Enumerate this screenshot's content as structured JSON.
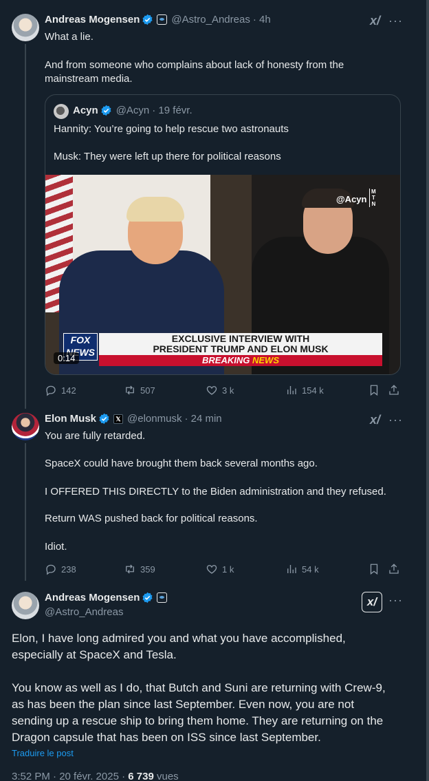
{
  "tweet1": {
    "name": "Andreas Mogensen",
    "handle": "@Astro_Andreas",
    "time": "· 4h",
    "lines": [
      "What a lie.",
      "And from someone who complains about lack of honesty from the",
      "mainstream media."
    ],
    "quote": {
      "name": "Acyn",
      "handle": "@Acyn",
      "time": "· 19 févr.",
      "lines": [
        "Hannity: You’re going to help rescue two astronauts",
        "Musk: They were left up there for political reasons"
      ],
      "video": {
        "tag": "@Acyn",
        "mtn": "M\nT\nN",
        "network": "FOX NEWS",
        "banner1": "EXCLUSIVE INTERVIEW WITH",
        "banner2": "PRESIDENT TRUMP AND ELON MUSK",
        "breaking1": "BREAKING",
        "breaking2": "NEWS",
        "duration": "0:14"
      }
    },
    "stats": {
      "replies": "142",
      "reposts": "507",
      "likes": "3 k",
      "views": "154 k"
    }
  },
  "tweet2": {
    "name": "Elon Musk",
    "badge": "𝕏",
    "handle": "@elonmusk",
    "time": "· 24 min",
    "lines": [
      "You are fully retarded.",
      "SpaceX could have brought them back several months ago.",
      "I OFFERED THIS DIRECTLY to the Biden administration and they refused.",
      "Return WAS pushed back for political reasons.",
      "Idiot."
    ],
    "stats": {
      "replies": "238",
      "reposts": "359",
      "likes": "1 k",
      "views": "54 k"
    }
  },
  "tweet3": {
    "name": "Andreas Mogensen",
    "handle": "@Astro_Andreas",
    "lines": [
      "Elon, I have long admired you and what you have accomplished,",
      "especially at SpaceX and Tesla.",
      "You know as well as I do, that Butch and Suni are returning with Crew-9,",
      "as has been the plan since last September. Even now, you are not",
      "sending up a rescue ship to bring them home. They are returning on the",
      "Dragon capsule that has been on ISS since last September."
    ],
    "translate": "Traduire le post",
    "meta_time": "3:52 PM · 20 févr. 2025 · ",
    "views_count": "6 739",
    "views_label": " vues"
  },
  "icons": {
    "grok": "x/",
    "more": "···"
  }
}
